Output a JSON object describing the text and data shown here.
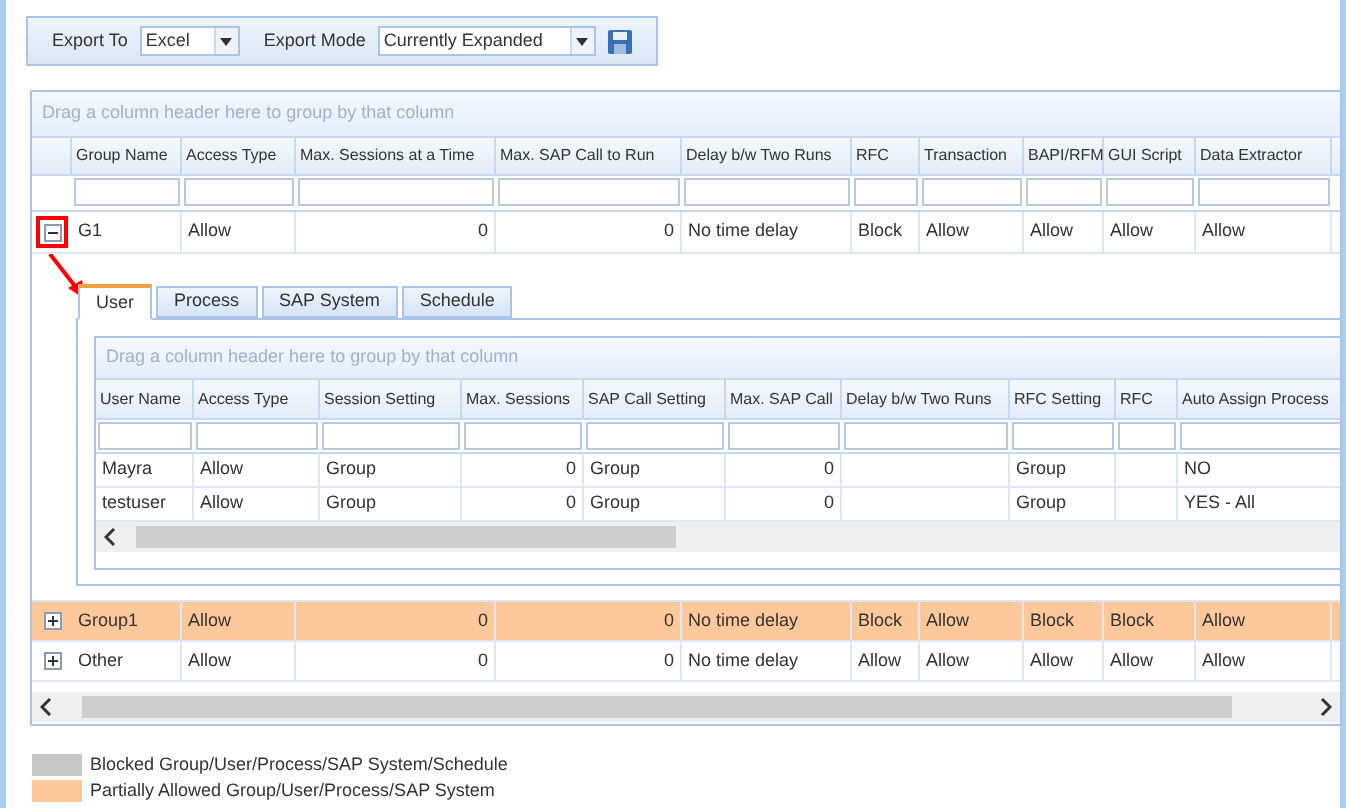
{
  "toolbar": {
    "export_to_label": "Export To",
    "export_to": "Excel",
    "export_mode_label": "Export Mode",
    "export_mode": "Currently Expanded"
  },
  "grid": {
    "group_panel": "Drag a column header here to group by that column",
    "columns": [
      "Group Name",
      "Access Type",
      "Max. Sessions at a Time",
      "Max. SAP Call to Run",
      "Delay b/w Two Runs",
      "RFC",
      "Transaction",
      "BAPI/RFM",
      "GUI Script",
      "Data Extractor"
    ],
    "rows": [
      {
        "kind": "normal",
        "expanded": true,
        "cells": [
          "G1",
          "Allow",
          "0",
          "0",
          "No time delay",
          "Block",
          "Allow",
          "Allow",
          "Allow",
          "Allow"
        ],
        "detail": {
          "tabs": [
            {
              "label": "User",
              "selected": true
            },
            {
              "label": "Process",
              "selected": false
            },
            {
              "label": "SAP System",
              "selected": false
            },
            {
              "label": "Schedule",
              "selected": false
            }
          ],
          "group_panel": "Drag a column header here to group by that column",
          "columns": [
            "User Name",
            "Access Type",
            "Session Setting",
            "Max. Sessions",
            "SAP Call Setting",
            "Max. SAP Call",
            "Delay b/w Two Runs",
            "RFC Setting",
            "RFC",
            "Auto Assign Process"
          ],
          "rows": [
            {
              "cells": [
                "Mayra",
                "Allow",
                "Group",
                "0",
                "Group",
                "0",
                "",
                "Group",
                "",
                "NO"
              ]
            },
            {
              "cells": [
                "testuser",
                "Allow",
                "Group",
                "0",
                "Group",
                "0",
                "",
                "Group",
                "",
                "YES - All"
              ]
            }
          ]
        }
      },
      {
        "kind": "partial",
        "expanded": false,
        "cells": [
          "Group1",
          "Allow",
          "0",
          "0",
          "No time delay",
          "Block",
          "Allow",
          "Block",
          "Block",
          "Allow"
        ]
      },
      {
        "kind": "normal",
        "expanded": false,
        "cells": [
          "Other",
          "Allow",
          "0",
          "0",
          "No time delay",
          "Allow",
          "Allow",
          "Allow",
          "Allow",
          "Allow"
        ]
      }
    ]
  },
  "legend": [
    {
      "label": "Blocked Group/User/Process/SAP System/Schedule",
      "color": "#c8c8c8"
    },
    {
      "label": "Partially Allowed Group/User/Process/SAP System",
      "color": "#fdc99a"
    }
  ]
}
